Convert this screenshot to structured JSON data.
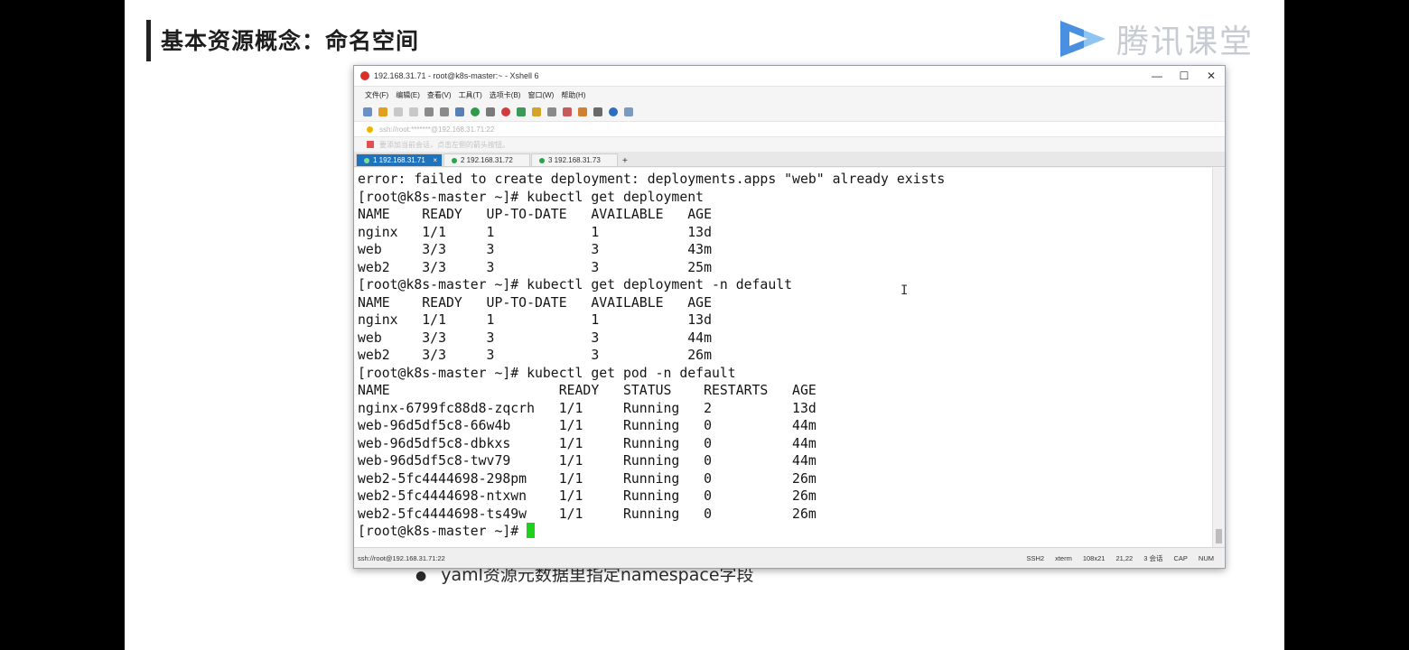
{
  "slide": {
    "title": "基本资源概念：命名空间",
    "brand": "腾讯课堂",
    "bullet_text": "yaml资源元数据里指定namespace字段"
  },
  "window": {
    "title": "192.168.31.71 - root@k8s-master:~ - Xshell 6",
    "controls": {
      "minimize": "—",
      "maximize": "☐",
      "close": "✕"
    },
    "menu": [
      "文件(F)",
      "编辑(E)",
      "查看(V)",
      "工具(T)",
      "选项卡(B)",
      "窗口(W)",
      "帮助(H)"
    ],
    "address": "ssh://root:*******@192.168.31.71:22",
    "hint": "要添加当前会话，点击左侧的箭头按钮。",
    "tabs": [
      {
        "label": "1 192.168.31.71",
        "active": true
      },
      {
        "label": "2 192.168.31.72",
        "active": false
      },
      {
        "label": "3 192.168.31.73",
        "active": false
      }
    ],
    "tab_add": "+",
    "tab_close": "×"
  },
  "terminal": {
    "lines": [
      "error: failed to create deployment: deployments.apps \"web\" already exists",
      "[root@k8s-master ~]# kubectl get deployment",
      "NAME    READY   UP-TO-DATE   AVAILABLE   AGE",
      "nginx   1/1     1            1           13d",
      "web     3/3     3            3           43m",
      "web2    3/3     3            3           25m",
      "[root@k8s-master ~]# kubectl get deployment -n default",
      "NAME    READY   UP-TO-DATE   AVAILABLE   AGE",
      "nginx   1/1     1            1           13d",
      "web     3/3     3            3           44m",
      "web2    3/3     3            3           26m",
      "[root@k8s-master ~]# kubectl get pod -n default",
      "NAME                     READY   STATUS    RESTARTS   AGE",
      "nginx-6799fc88d8-zqcrh   1/1     Running   2          13d",
      "web-96d5df5c8-66w4b      1/1     Running   0          44m",
      "web-96d5df5c8-dbkxs      1/1     Running   0          44m",
      "web-96d5df5c8-twv79      1/1     Running   0          44m",
      "web2-5fc4444698-298pm    1/1     Running   0          26m",
      "web2-5fc4444698-ntxwn    1/1     Running   0          26m",
      "web2-5fc4444698-ts49w    1/1     Running   0          26m"
    ],
    "prompt": "[root@k8s-master ~]# "
  },
  "statusbar": {
    "left": "ssh://root@192.168.31.71:22",
    "items": [
      "SSH2",
      "xterm",
      "108x21",
      "21,22",
      "3 会话",
      "CAP",
      "NUM"
    ]
  },
  "colors": {
    "tab_active": "#1e73be",
    "cursor": "#1dd11d",
    "brand_icon": "#4a90e2"
  }
}
